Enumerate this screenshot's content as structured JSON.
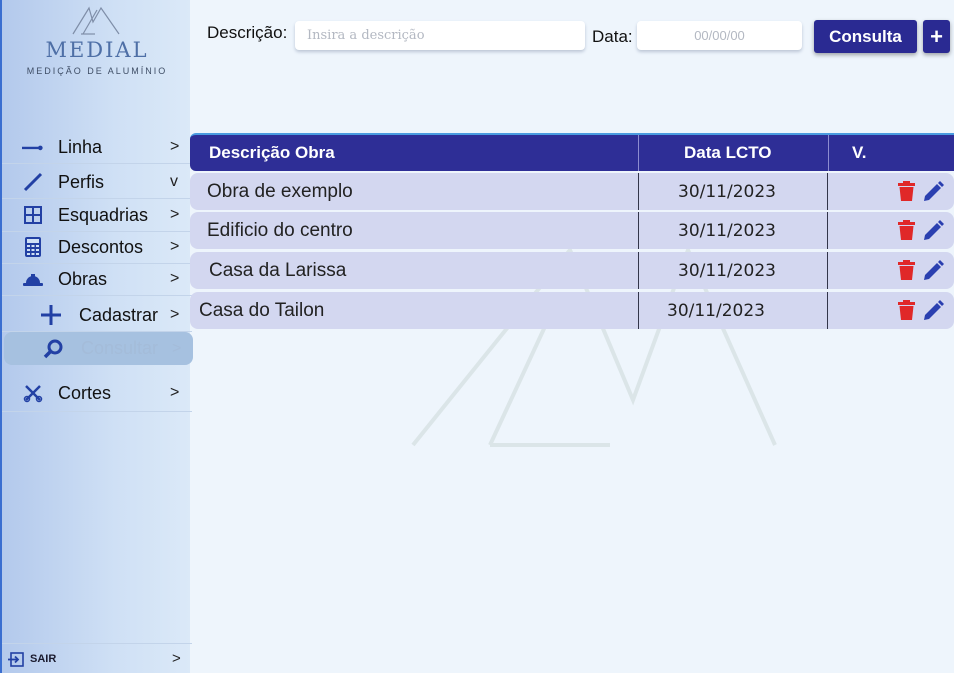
{
  "app": {
    "logo_title": "MEDIAL",
    "logo_subtitle": "MEDIÇÃO DE ALUMÍNIO"
  },
  "sidebar": {
    "items": [
      {
        "label": "Linha",
        "icon": "line-icon",
        "chevron": ">"
      },
      {
        "label": "Perfis",
        "icon": "slash-icon",
        "chevron": "v"
      },
      {
        "label": "Esquadrias",
        "icon": "window-frame-icon",
        "chevron": ">"
      },
      {
        "label": "Descontos",
        "icon": "calculator-icon",
        "chevron": ">"
      },
      {
        "label": "Obras",
        "icon": "hardhat-icon",
        "chevron": ">"
      },
      {
        "label": "Cadastrar",
        "icon": "plus-icon",
        "chevron": ">"
      },
      {
        "label": "Consultar",
        "icon": "search-icon",
        "chevron": ">"
      },
      {
        "label": "Cortes",
        "icon": "tools-icon",
        "chevron": ">"
      }
    ],
    "logout_label": "SAIR",
    "logout_chevron": ">"
  },
  "search": {
    "description_label": "Descrição:",
    "description_placeholder": "Insira a descrição",
    "date_label": "Data:",
    "date_placeholder": "00/00/00",
    "consult_button": "Consulta",
    "add_button": "+"
  },
  "table": {
    "headers": [
      "Descrição Obra",
      "Data LCTO",
      "V."
    ],
    "rows": [
      {
        "descricao": "Obra de exemplo",
        "data": "30/11/2023"
      },
      {
        "descricao": "Edificio do centro",
        "data": "30/11/2023"
      },
      {
        "descricao": "Casa da Larissa",
        "data": "30/11/2023"
      },
      {
        "descricao": "Casa do Tailon",
        "data": "30/11/2023"
      }
    ]
  },
  "colors": {
    "primary": "#2a2a92",
    "header": "#2e2e96",
    "row": "#d3d7f0",
    "delete": "#e02828",
    "edit": "#2a3fb0"
  }
}
